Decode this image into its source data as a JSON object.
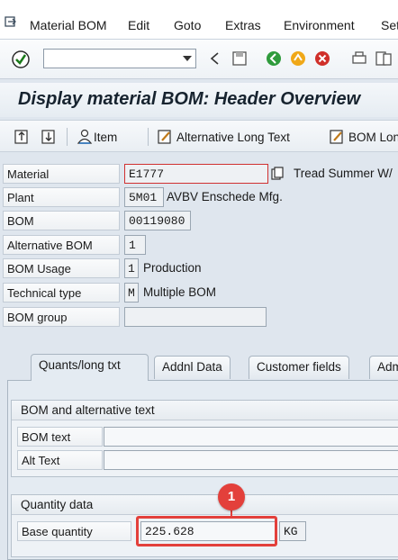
{
  "menubar": {
    "items": [
      "Material BOM",
      "Edit",
      "Goto",
      "Extras",
      "Environment",
      "Set"
    ]
  },
  "toolbar": {
    "command_value": ""
  },
  "page": {
    "title": "Display material BOM: Header Overview"
  },
  "app_toolbar": {
    "item_label": "Item",
    "alt_long_text_label": "Alternative Long Text",
    "bom_long_label": "BOM Lon"
  },
  "header_fields": {
    "material": {
      "label": "Material",
      "value": "E1777",
      "description": "Tread Summer W/"
    },
    "plant": {
      "label": "Plant",
      "value": "5M01",
      "description": "AVBV Enschede Mfg."
    },
    "bom": {
      "label": "BOM",
      "value": "00119080"
    },
    "alternative_bom": {
      "label": "Alternative BOM",
      "value": "1"
    },
    "bom_usage": {
      "label": "BOM Usage",
      "value": "1",
      "description": "Production"
    },
    "technical_type": {
      "label": "Technical type",
      "value": "M",
      "description": "Multiple BOM"
    },
    "bom_group": {
      "label": "BOM group",
      "value": ""
    }
  },
  "tabs": [
    "Quants/long txt",
    "Addnl Data",
    "Customer fields",
    "Adm"
  ],
  "bom_alt_text_group": {
    "title": "BOM and alternative text",
    "bom_text_label": "BOM text",
    "alt_text_label": "Alt Text"
  },
  "quantity_group": {
    "title": "Quantity data",
    "base_quantity_label": "Base quantity",
    "base_quantity_value": "225.628",
    "unit": "KG"
  },
  "annotation": {
    "callout_number": "1",
    "color": "#e3403b"
  }
}
